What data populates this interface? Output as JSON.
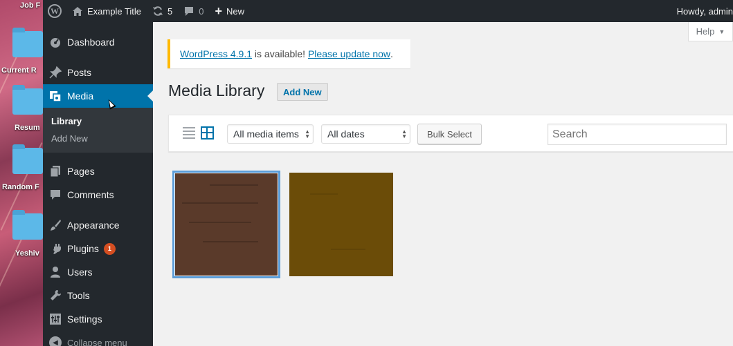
{
  "desktop": {
    "labels": [
      "Job F",
      "Current R",
      "Resum",
      "Random F",
      "Yeshiv"
    ]
  },
  "adminbar": {
    "site_title": "Example Title",
    "updates_count": "5",
    "comments_count": "0",
    "new_label": "New",
    "howdy": "Howdy, admin"
  },
  "sidebar": {
    "items": [
      {
        "label": "Dashboard",
        "icon": "dashboard-icon"
      },
      {
        "label": "Posts",
        "icon": "pin-icon"
      },
      {
        "label": "Media",
        "icon": "media-icon"
      },
      {
        "label": "Pages",
        "icon": "page-icon"
      },
      {
        "label": "Comments",
        "icon": "comment-icon"
      },
      {
        "label": "Appearance",
        "icon": "brush-icon"
      },
      {
        "label": "Plugins",
        "icon": "plugin-icon"
      },
      {
        "label": "Users",
        "icon": "user-icon"
      },
      {
        "label": "Tools",
        "icon": "wrench-icon"
      },
      {
        "label": "Settings",
        "icon": "settings-icon"
      }
    ],
    "submenu": [
      "Library",
      "Add New"
    ],
    "plugins_badge": "1",
    "collapse_label": "Collapse menu"
  },
  "content": {
    "help_label": "Help",
    "notice": {
      "version_link": "WordPress 4.9.1",
      "middle_text": " is available! ",
      "update_link": "Please update now",
      "end_text": "."
    },
    "title": "Media Library",
    "add_new_label": "Add New",
    "toolbar": {
      "media_filter": "All media items",
      "date_filter": "All dates",
      "bulk_select_label": "Bulk Select",
      "search_placeholder": "Search"
    }
  },
  "colors": {
    "accent": "#0073aa",
    "adminbar_bg": "#23282d",
    "notice_border": "#ffb900",
    "badge": "#d54e21",
    "thumb1": "#5a3a2a",
    "thumb2": "#6b4c08"
  }
}
